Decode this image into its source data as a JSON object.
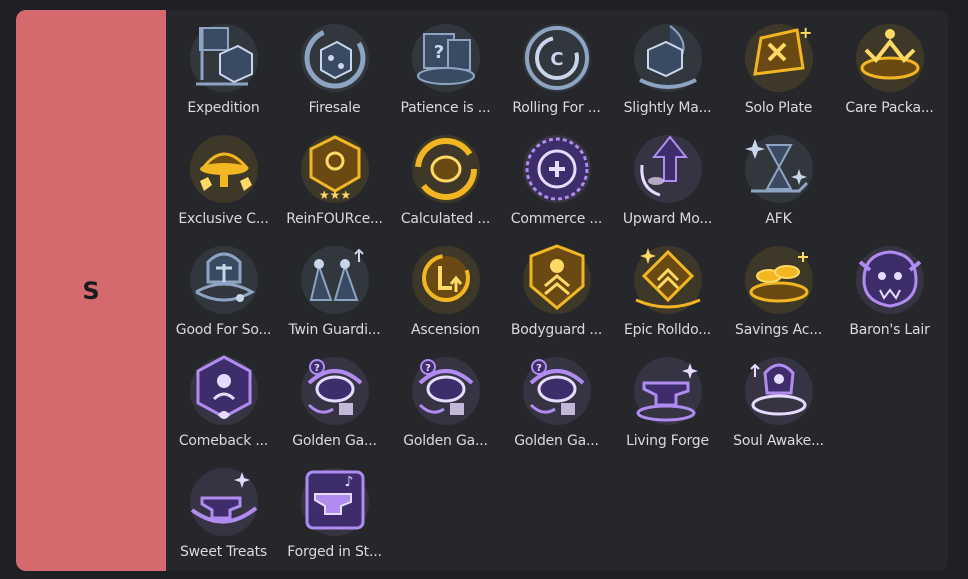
{
  "tier": {
    "label": "S",
    "color": "#d46a6d"
  },
  "items": [
    {
      "label": "Expedition",
      "icon": "expedition-icon",
      "theme": "silver"
    },
    {
      "label": "Firesale",
      "icon": "firesale-icon",
      "theme": "silver"
    },
    {
      "label": "Patience is ...",
      "icon": "patience-icon",
      "theme": "silver"
    },
    {
      "label": "Rolling For ...",
      "icon": "rolling-icon",
      "theme": "silver"
    },
    {
      "label": "Slightly Ma...",
      "icon": "slightly-magic-icon",
      "theme": "silver"
    },
    {
      "label": "Solo Plate",
      "icon": "solo-plate-icon",
      "theme": "gold"
    },
    {
      "label": "Care Packa...",
      "icon": "care-package-icon",
      "theme": "gold"
    },
    {
      "label": "Exclusive C...",
      "icon": "exclusive-icon",
      "theme": "gold"
    },
    {
      "label": "ReinFOURce...",
      "icon": "reinfource-icon",
      "theme": "gold"
    },
    {
      "label": "Calculated ...",
      "icon": "calculated-icon",
      "theme": "gold"
    },
    {
      "label": "Commerce ...",
      "icon": "commerce-icon",
      "theme": "prismatic"
    },
    {
      "label": "Upward Mo...",
      "icon": "upward-icon",
      "theme": "prismatic"
    },
    {
      "label": "AFK",
      "icon": "hourglass-icon",
      "theme": "silver"
    },
    {
      "label": "",
      "icon": "",
      "theme": "empty"
    },
    {
      "label": "Good For So...",
      "icon": "good-for-something-icon",
      "theme": "silver"
    },
    {
      "label": "Twin Guardi...",
      "icon": "twin-guardians-icon",
      "theme": "silver"
    },
    {
      "label": "Ascension",
      "icon": "ascension-icon",
      "theme": "gold"
    },
    {
      "label": "Bodyguard ...",
      "icon": "bodyguard-icon",
      "theme": "gold"
    },
    {
      "label": "Epic Rolldo...",
      "icon": "epic-rolldown-icon",
      "theme": "gold"
    },
    {
      "label": "Savings Ac...",
      "icon": "savings-icon",
      "theme": "gold"
    },
    {
      "label": "Baron's Lair",
      "icon": "baron-icon",
      "theme": "prismatic"
    },
    {
      "label": "Comeback ...",
      "icon": "comeback-icon",
      "theme": "prismatic"
    },
    {
      "label": "Golden Ga...",
      "icon": "golden-gadgets-icon",
      "theme": "prismatic"
    },
    {
      "label": "Golden Ga...",
      "icon": "golden-gadgets-icon",
      "theme": "prismatic"
    },
    {
      "label": "Golden Ga...",
      "icon": "golden-gadgets-icon",
      "theme": "prismatic"
    },
    {
      "label": "Living Forge",
      "icon": "anvil-icon",
      "theme": "prismatic"
    },
    {
      "label": "Soul Awake...",
      "icon": "soul-awakening-icon",
      "theme": "prismatic"
    },
    {
      "label": "",
      "icon": "",
      "theme": "empty"
    },
    {
      "label": "Sweet Treats",
      "icon": "sweet-treats-icon",
      "theme": "prismatic"
    },
    {
      "label": "Forged in St...",
      "icon": "forged-icon",
      "theme": "prismatic"
    }
  ],
  "themes": {
    "silver": {
      "ring": "#8da4c2",
      "fill": "#3b4a63",
      "accent": "#c9d6ea"
    },
    "gold": {
      "ring": "#f2b623",
      "fill": "#6a4a12",
      "accent": "#ffd966"
    },
    "prismatic": {
      "ring": "#b08cf0",
      "fill": "#3d2d6a",
      "accent": "#e6dbff"
    }
  }
}
